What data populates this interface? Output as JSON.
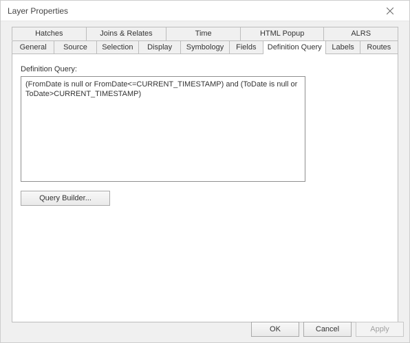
{
  "window": {
    "title": "Layer Properties"
  },
  "tabs": {
    "row1": [
      "Hatches",
      "Joins & Relates",
      "Time",
      "HTML Popup",
      "ALRS"
    ],
    "row2": [
      "General",
      "Source",
      "Selection",
      "Display",
      "Symbology",
      "Fields",
      "Definition Query",
      "Labels",
      "Routes"
    ],
    "active": "Definition Query"
  },
  "panel": {
    "label": "Definition Query:",
    "query_value": "(FromDate is null or FromDate<=CURRENT_TIMESTAMP) and (ToDate is null or ToDate>CURRENT_TIMESTAMP)",
    "query_builder_label": "Query Builder..."
  },
  "buttons": {
    "ok": "OK",
    "cancel": "Cancel",
    "apply": "Apply"
  }
}
